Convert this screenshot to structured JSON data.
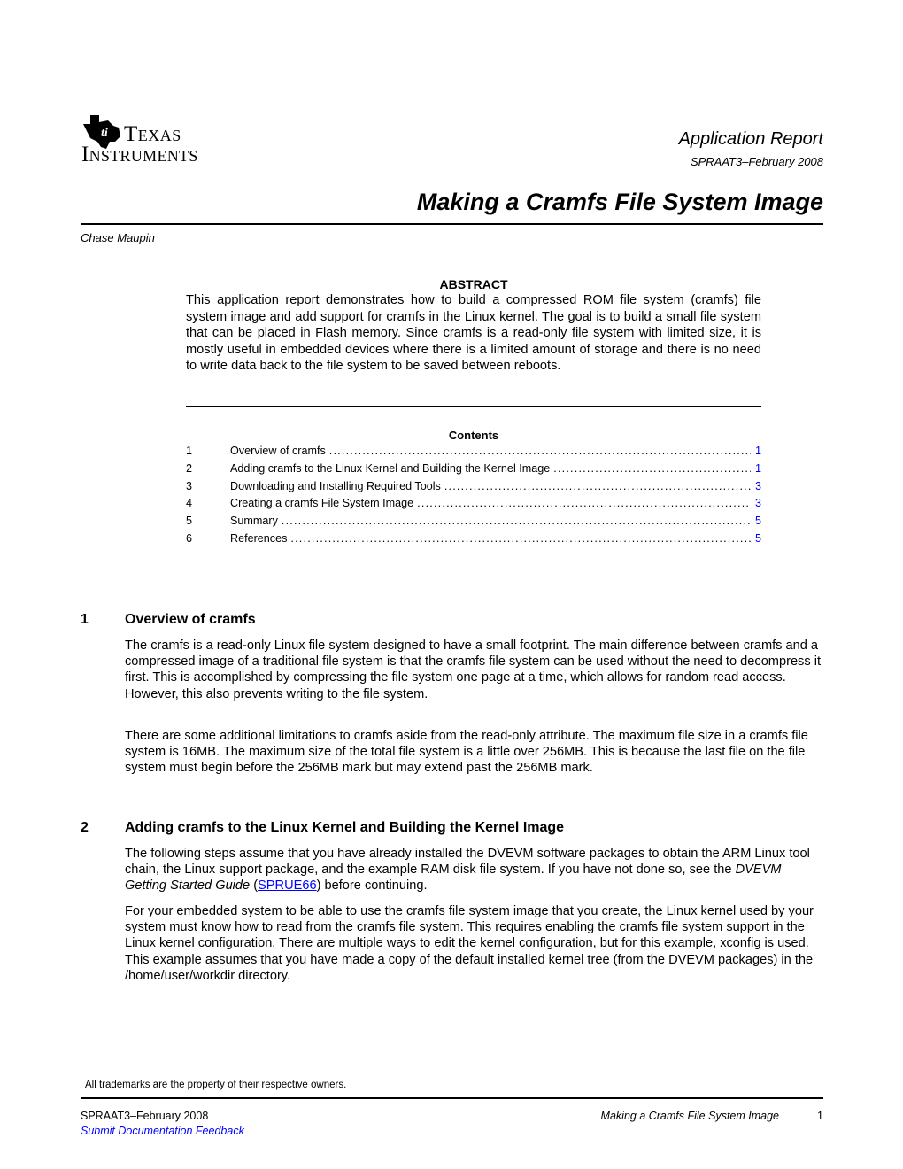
{
  "header": {
    "logo_line1": "Texas",
    "logo_line2": "Instruments",
    "report_type": "Application Report",
    "doc_id": "SPRAAT3–February 2008",
    "title": "Making a Cramfs File System Image",
    "author": "Chase Maupin"
  },
  "abstract": {
    "heading": "ABSTRACT",
    "body": "This application report demonstrates how to build a compressed ROM file system (cramfs) file system image and add support for cramfs in the Linux kernel. The goal is to build a small file system that can be placed in Flash memory. Since cramfs is a read-only file system with limited size, it is mostly useful in embedded devices where there is a limited amount of storage and there is no need to write data back to the file system to be saved between reboots."
  },
  "contents": {
    "heading": "Contents",
    "items": [
      {
        "num": "1",
        "title": "Overview of cramfs",
        "page": "1"
      },
      {
        "num": "2",
        "title": "Adding cramfs to the Linux Kernel and Building the Kernel Image",
        "page": "1"
      },
      {
        "num": "3",
        "title": "Downloading and Installing Required Tools",
        "page": "3"
      },
      {
        "num": "4",
        "title": "Creating a cramfs File System Image",
        "page": "3"
      },
      {
        "num": "5",
        "title": "Summary",
        "page": "5"
      },
      {
        "num": "6",
        "title": "References",
        "page": "5"
      }
    ]
  },
  "sections": [
    {
      "num": "1",
      "title": "Overview of cramfs",
      "paragraphs": [
        "The cramfs is a read-only Linux file system designed to have a small footprint. The main difference between cramfs and a compressed image of a traditional file system is that the cramfs file system can be used without the need to decompress it first. This is accomplished by compressing the file system one page at a time, which allows for random read access. However, this also prevents writing to the file system.",
        "There are some additional limitations to cramfs aside from the read-only attribute. The maximum file size in a cramfs file system is 16MB. The maximum size of the total file system is a little over 256MB. This is because the last file on the file system must begin before the 256MB mark but may extend past the 256MB mark."
      ]
    },
    {
      "num": "2",
      "title": "Adding cramfs to the Linux Kernel and Building the Kernel Image",
      "p1_before": "The following steps assume that you have already installed the DVEVM software packages to obtain the ARM Linux tool chain, the Linux support package, and the example RAM disk file system. If you have not done so, see the ",
      "p1_italic": "DVEVM Getting Started Guide",
      "p1_open": " (",
      "p1_link": "SPRUE66",
      "p1_after": ") before continuing.",
      "p2": "For your embedded system to be able to use the cramfs file system image that you create, the Linux kernel used by your system must know how to read from the cramfs file system. This requires enabling the cramfs file system support in the Linux kernel configuration. There are multiple ways to edit the kernel configuration, but for this example, xconfig is used. This example assumes that you have made a copy of the default installed kernel tree (from the DVEVM packages) in the /home/user/workdir directory."
    }
  ],
  "trademark_note": "All trademarks are the property of their respective owners.",
  "footer": {
    "doc_id": "SPRAAT3–February 2008",
    "feedback_link": "Submit Documentation Feedback",
    "title": "Making a Cramfs File System Image",
    "page": "1"
  },
  "colors": {
    "link": "#0000ff",
    "text": "#000000"
  }
}
